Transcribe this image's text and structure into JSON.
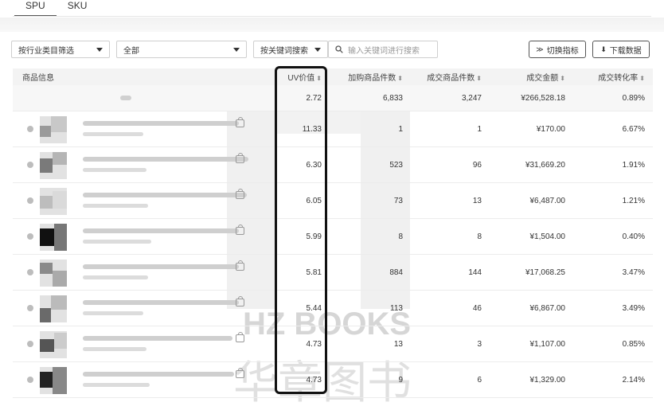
{
  "tabs": [
    {
      "label": "SPU",
      "active": true
    },
    {
      "label": "SKU",
      "active": false
    }
  ],
  "filters": {
    "category_select": "按行业类目筛选",
    "value_select": "全部",
    "keyword_select": "按关键词搜索",
    "search_placeholder": "输入关键词进行搜索",
    "switch_metrics": "切换指标",
    "download": "下载数据"
  },
  "table": {
    "headers": [
      "商品信息",
      "UV价值",
      "加购商品件数",
      "成交商品件数",
      "成交金额",
      "成交转化率"
    ],
    "summary": {
      "uv": "2.72",
      "cart": "6,833",
      "sold": "3,247",
      "amount": "¥266,528.18",
      "rate": "0.89%"
    },
    "rows": [
      {
        "uv": "11.33",
        "cart": "1",
        "sold": "1",
        "amount": "¥170.00",
        "rate": "6.67%"
      },
      {
        "uv": "6.30",
        "cart": "523",
        "sold": "96",
        "amount": "¥31,669.20",
        "rate": "1.91%"
      },
      {
        "uv": "6.05",
        "cart": "73",
        "sold": "13",
        "amount": "¥6,487.00",
        "rate": "1.21%"
      },
      {
        "uv": "5.99",
        "cart": "8",
        "sold": "8",
        "amount": "¥1,504.00",
        "rate": "0.40%"
      },
      {
        "uv": "5.81",
        "cart": "884",
        "sold": "144",
        "amount": "¥17,068.25",
        "rate": "3.47%"
      },
      {
        "uv": "5.44",
        "cart": "113",
        "sold": "46",
        "amount": "¥6,867.00",
        "rate": "3.49%"
      },
      {
        "uv": "4.73",
        "cart": "13",
        "sold": "3",
        "amount": "¥1,107.00",
        "rate": "0.85%"
      },
      {
        "uv": "4.73",
        "cart": "9",
        "sold": "6",
        "amount": "¥1,329.00",
        "rate": "2.14%"
      }
    ]
  },
  "watermark": {
    "latin": "HZ BOOKS",
    "cjk": "华章图书"
  },
  "colors": {
    "header_bg": "#f3f3f3",
    "highlight_border": "#111111",
    "watermark": "#d8d8d8"
  }
}
